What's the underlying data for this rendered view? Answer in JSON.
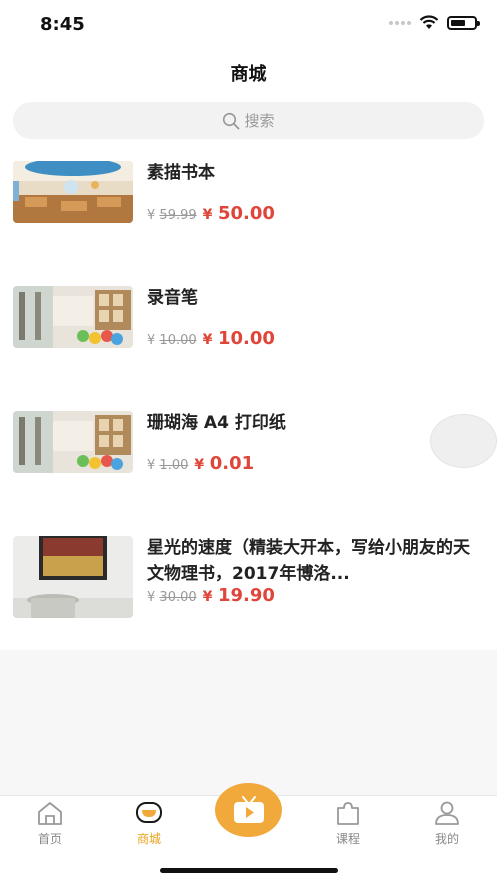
{
  "status_bar": {
    "time": "8:45"
  },
  "nav": {
    "title": "商城"
  },
  "search": {
    "placeholder": "搜索"
  },
  "products": [
    {
      "title": "素描书本",
      "old_price_symbol": "¥",
      "old_price": "59.99",
      "price_symbol": "¥",
      "price": "50.00"
    },
    {
      "title": "录音笔",
      "old_price_symbol": "¥",
      "old_price": "10.00",
      "price_symbol": "¥",
      "price": "10.00"
    },
    {
      "title": "珊瑚海 A4 打印纸",
      "old_price_symbol": "¥",
      "old_price": "1.00",
      "price_symbol": "¥",
      "price": "0.01"
    },
    {
      "title": "星光的速度（精装大开本，写给小朋友的天文物理书，2017年博洛...",
      "old_price_symbol": "¥",
      "old_price": "30.00",
      "price_symbol": "¥",
      "price": "19.90"
    }
  ],
  "tabs": [
    {
      "label": "首页",
      "icon": "home-icon"
    },
    {
      "label": "商城",
      "icon": "shop-icon"
    },
    {
      "label": "",
      "icon": "tv-icon"
    },
    {
      "label": "课程",
      "icon": "puzzle-icon"
    },
    {
      "label": "我的",
      "icon": "user-icon"
    }
  ],
  "colors": {
    "accent": "#e9a21a",
    "price": "#e0453a",
    "center_button": "#f2a93b"
  }
}
